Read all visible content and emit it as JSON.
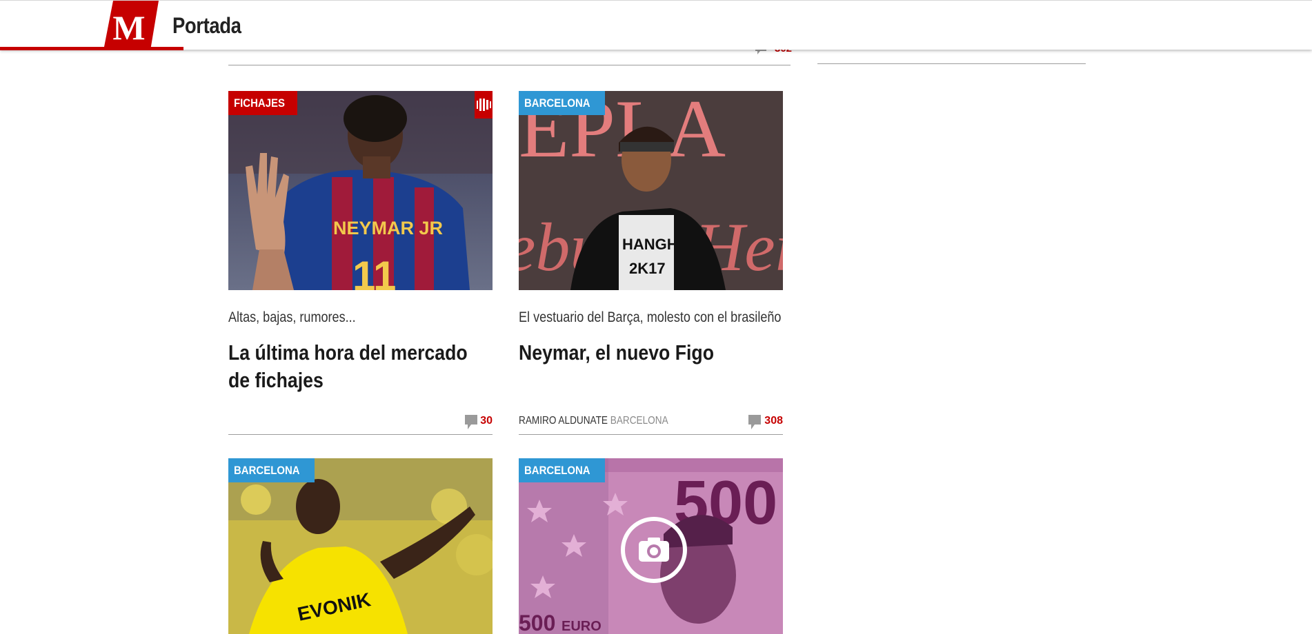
{
  "header": {
    "logo_letter": "M",
    "title": "Portada"
  },
  "previous_row": {
    "comment_count": "302"
  },
  "colors": {
    "brand_red": "#c60000",
    "section_blue": "#2f97d4"
  },
  "articles": [
    {
      "section": "FICHAJES",
      "badge_color": "red",
      "has_video": true,
      "kicker": "Altas, bajas, rumores...",
      "headline": "La última hora del mercado de fichajes",
      "author": "",
      "place": "",
      "comments": "30"
    },
    {
      "section": "BARCELONA",
      "badge_color": "blue",
      "has_video": false,
      "kicker": "El vestuario del Barça, molesto con el brasileño",
      "headline": "Neymar, el nuevo Figo",
      "author": "RAMIRO ALDUNATE",
      "place": "BARCELONA",
      "comments": "308"
    },
    {
      "section": "BARCELONA",
      "badge_color": "blue",
      "has_gallery": false
    },
    {
      "section": "BARCELONA",
      "badge_color": "blue",
      "has_gallery": true
    }
  ],
  "icons": [
    "comment-icon",
    "video-icon",
    "camera-icon"
  ]
}
